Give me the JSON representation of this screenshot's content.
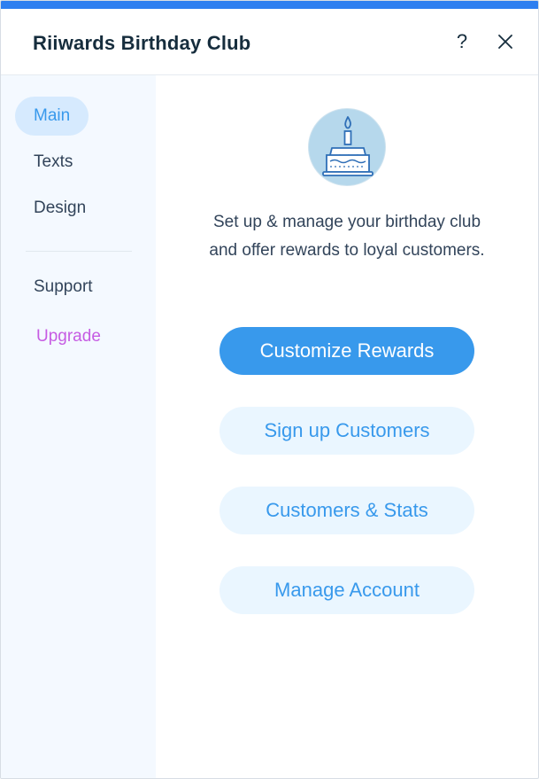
{
  "window": {
    "title": "Riiwards Birthday Club",
    "help_label": "?",
    "accent_color": "#2e7ff0"
  },
  "sidebar": {
    "items": [
      {
        "label": "Main",
        "active": true
      },
      {
        "label": "Texts",
        "active": false
      },
      {
        "label": "Design",
        "active": false
      }
    ],
    "secondary": [
      {
        "label": "Support"
      },
      {
        "label": "Upgrade",
        "color": "#c65ce3"
      }
    ]
  },
  "main": {
    "icon": "birthday-cake-icon",
    "description": "Set up & manage your birthday club and offer rewards to loyal customers.",
    "buttons": {
      "customize_rewards": "Customize Rewards",
      "sign_up_customers": "Sign up Customers",
      "customers_stats": "Customers & Stats",
      "manage_account": "Manage Account"
    },
    "primary_color": "#3899ec",
    "secondary_bg": "#eaf6ff"
  }
}
